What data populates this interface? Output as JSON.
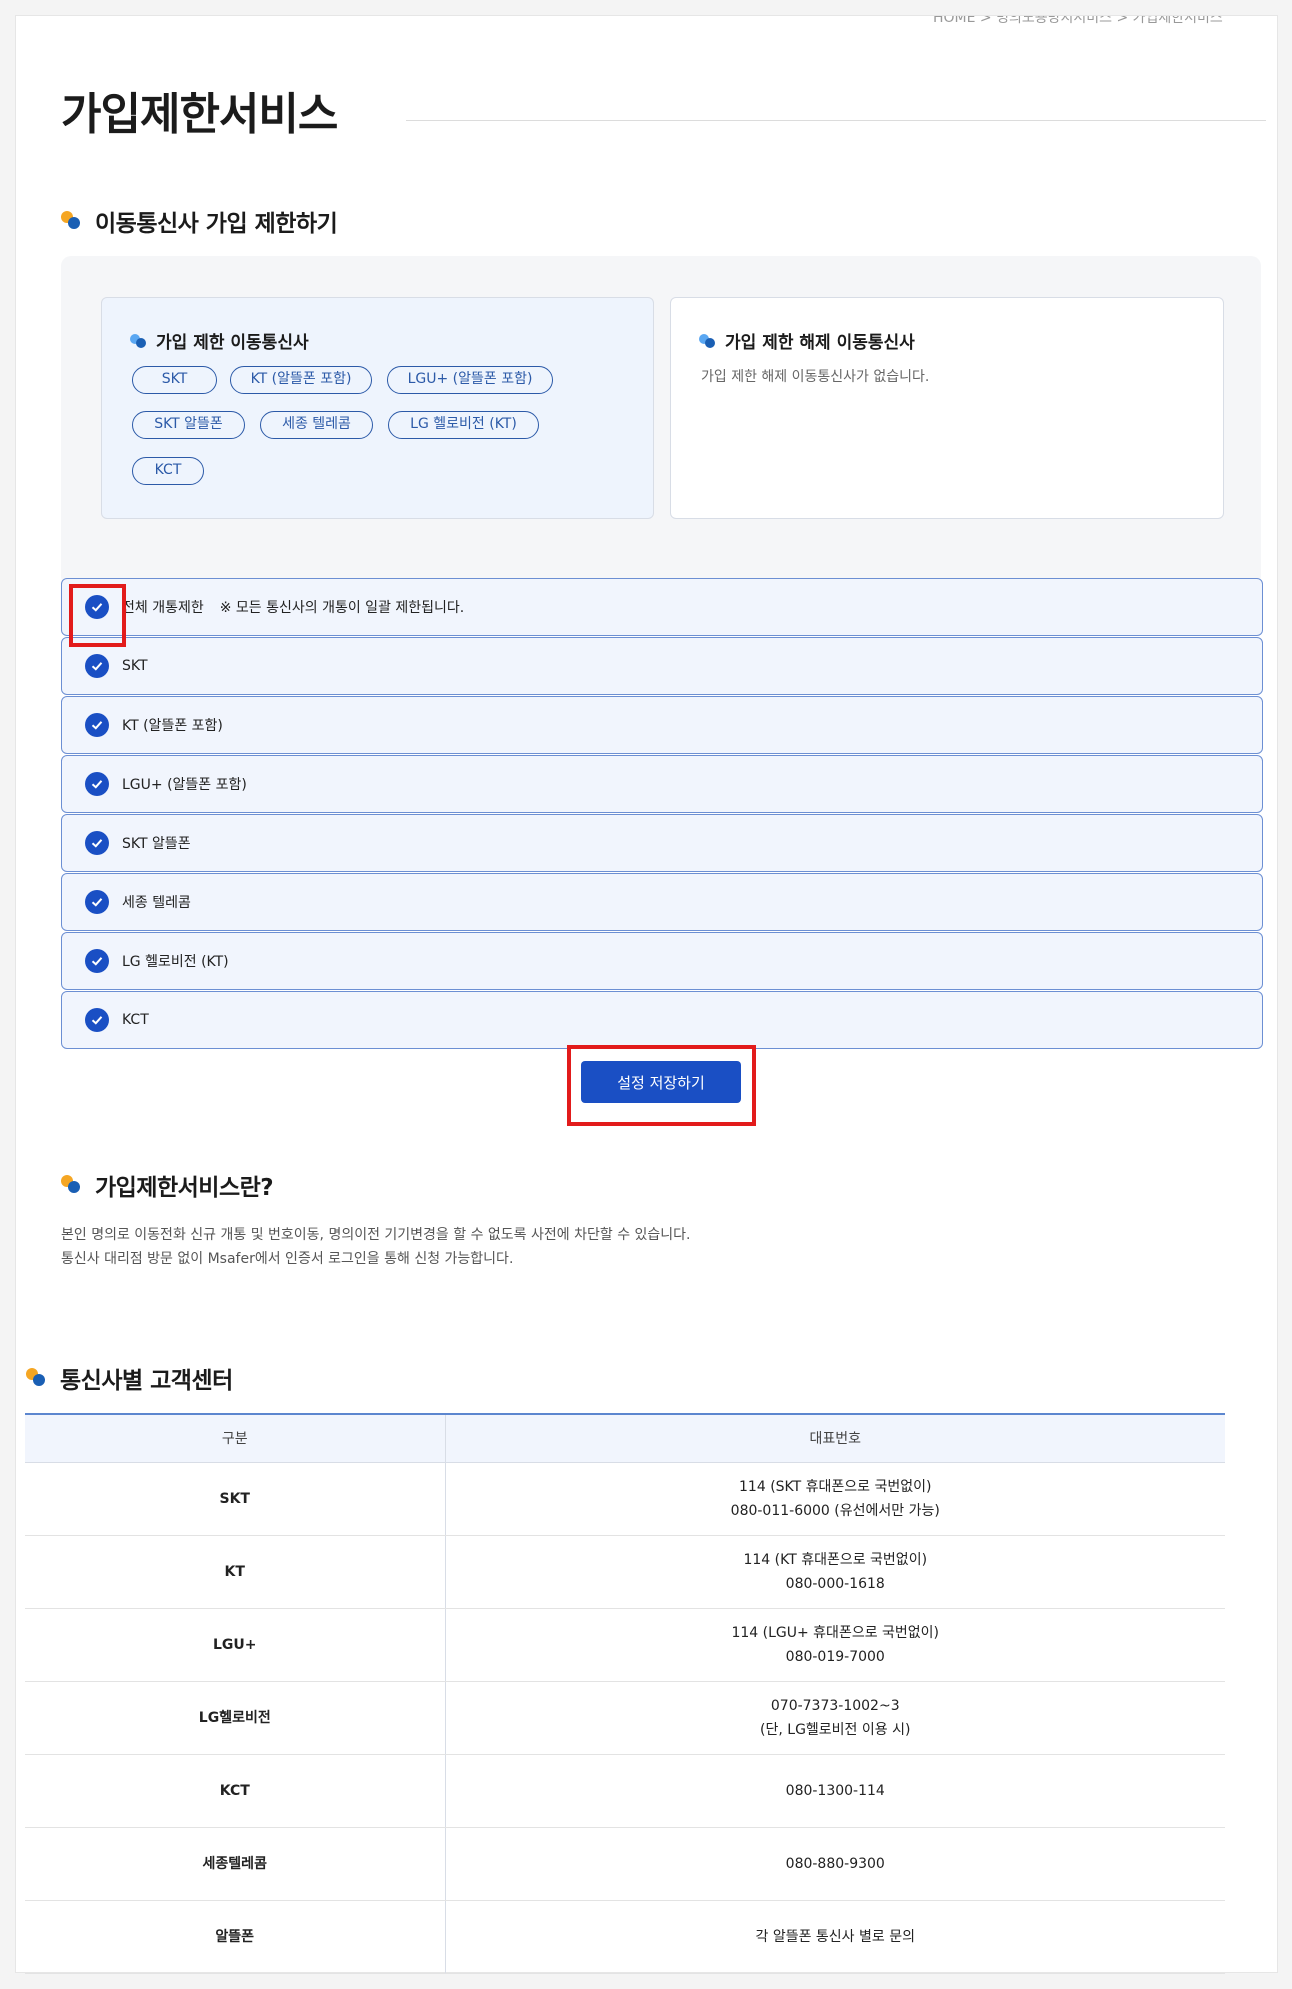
{
  "breadcrumb": "HOME  >  명의도용방지서비스  >  가입제한서비스",
  "page_title": "가입제한서비스",
  "section1": {
    "title": "이동통신사 가입 제한하기",
    "restricted_card": {
      "title": "가입 제한 이동통신사",
      "chips": [
        "SKT",
        "KT (알뜰폰 포함)",
        "LGU+ (알뜰폰 포함)",
        "SKT 알뜰폰",
        "세종 텔레콤",
        "LG 헬로비전 (KT)",
        "KCT"
      ]
    },
    "released_card": {
      "title": "가입 제한 해제 이동통신사",
      "empty_message": "가입 제한 해제 이동통신사가 없습니다."
    },
    "options": [
      {
        "label": "전체 개통제한",
        "note": "※ 모든 통신사의 개통이 일괄 제한됩니다.",
        "checked": true
      },
      {
        "label": "SKT",
        "checked": true
      },
      {
        "label": "KT (알뜰폰 포함)",
        "checked": true
      },
      {
        "label": "LGU+ (알뜰폰 포함)",
        "checked": true
      },
      {
        "label": "SKT 알뜰폰",
        "checked": true
      },
      {
        "label": "세종 텔레콤",
        "checked": true
      },
      {
        "label": "LG 헬로비전 (KT)",
        "checked": true
      },
      {
        "label": "KCT",
        "checked": true
      }
    ],
    "save_label": "설정 저장하기"
  },
  "section2": {
    "title": "가입제한서비스란?",
    "lines": [
      "본인 명의로 이동전화 신규 개통 및 번호이동, 명의이전 기기변경을 할 수 없도록 사전에 차단할 수 있습니다.",
      "통신사 대리점 방문 없이 Msafer에서 인증서 로그인을 통해 신청 가능합니다."
    ]
  },
  "section3": {
    "title": "통신사별 고객센터",
    "headers": [
      "구분",
      "대표번호"
    ],
    "rows": [
      {
        "name": "SKT",
        "line1": "114 (SKT 휴대폰으로 국번없이)",
        "line2": "080-011-6000 (유선에서만 가능)"
      },
      {
        "name": "KT",
        "line1": "114 (KT 휴대폰으로 국번없이)",
        "line2": "080-000-1618"
      },
      {
        "name": "LGU+",
        "line1": "114 (LGU+ 휴대폰으로 국번없이)",
        "line2": "080-019-7000"
      },
      {
        "name": "LG헬로비전",
        "line1": "070-7373-1002~3",
        "line2": "(단, LG헬로비전 이용 시)"
      },
      {
        "name": "KCT",
        "line1": "080-1300-114",
        "line2": ""
      },
      {
        "name": "세종텔레콤",
        "line1": "080-880-9300",
        "line2": ""
      },
      {
        "name": "알뜰폰",
        "line1": "각 알뜰폰 통신사 별로 문의",
        "line2": ""
      }
    ]
  },
  "colors": {
    "accent": "#1a4fc4",
    "highlight": "#e21b1b",
    "dot_orange": "#f5a623",
    "dot_blue": "#1a5fb4"
  }
}
